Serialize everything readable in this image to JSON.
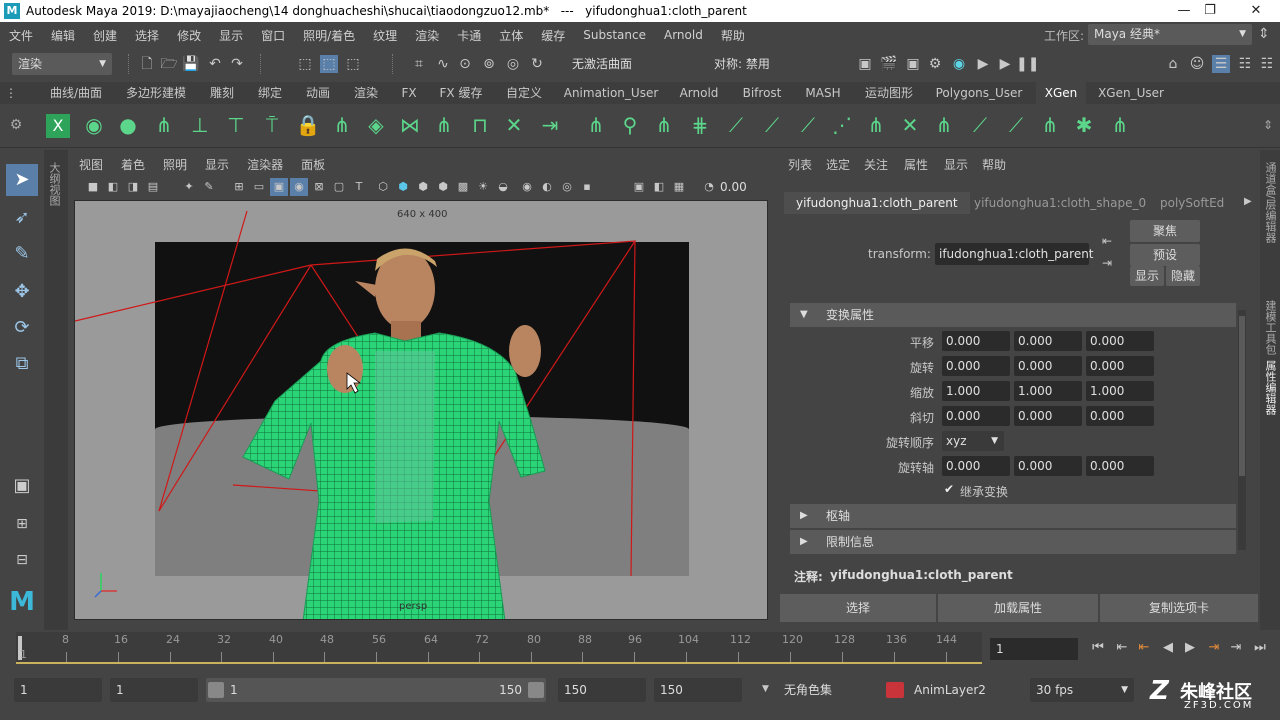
{
  "title_bar": {
    "title": "Autodesk Maya 2019: D:\\mayajiaocheng\\14 donghuacheshi\\shucai\\tiaodongzuo12.mb*   ---   yifudonghua1:cloth_parent",
    "logo": "M"
  },
  "menu": [
    "文件",
    "编辑",
    "创建",
    "选择",
    "修改",
    "显示",
    "窗口",
    "照明/着色",
    "纹理",
    "渲染",
    "卡通",
    "立体",
    "缓存",
    "Substance",
    "Arnold",
    "帮助"
  ],
  "workspace": {
    "label": "工作区:",
    "value": "Maya 经典*"
  },
  "status_line": {
    "menuset": "渲染",
    "live_surface": "无激活曲面",
    "symmetry": "对称: 禁用"
  },
  "shelf_tabs": [
    "曲线/曲面",
    "多边形建模",
    "雕刻",
    "绑定",
    "动画",
    "渲染",
    "FX",
    "FX 缓存",
    "自定义",
    "Animation_User",
    "Arnold",
    "Bifrost",
    "MASH",
    "运动图形",
    "Polygons_User",
    "XGen",
    "XGen_User"
  ],
  "shelf_active": "XGen",
  "panel_menu": [
    "视图",
    "着色",
    "照明",
    "显示",
    "渲染器",
    "面板"
  ],
  "panel_toolbar_value": "0.00",
  "viewport": {
    "resolution": "640 x 400",
    "camera": "persp"
  },
  "outliner_strip_label": "大纲视图",
  "attribute_editor": {
    "menu": [
      "列表",
      "选定",
      "关注",
      "属性",
      "显示",
      "帮助"
    ],
    "tabs": [
      "yifudonghua1:cloth_parent",
      "yifudonghua1:cloth_shape_0",
      "polySoftEd"
    ],
    "transform_label": "transform:",
    "transform_value": "ifudonghua1:cloth_parent",
    "btn_focus": "聚焦",
    "btn_presets": "预设",
    "btn_show": "显示",
    "btn_hide": "隐藏",
    "section_transform": "变换属性",
    "rows": [
      {
        "label": "平移",
        "x": "0.000",
        "y": "0.000",
        "z": "0.000"
      },
      {
        "label": "旋转",
        "x": "0.000",
        "y": "0.000",
        "z": "0.000"
      },
      {
        "label": "缩放",
        "x": "1.000",
        "y": "1.000",
        "z": "1.000"
      },
      {
        "label": "斜切",
        "x": "0.000",
        "y": "0.000",
        "z": "0.000"
      }
    ],
    "rotate_order_label": "旋转顺序",
    "rotate_order_value": "xyz",
    "rotate_axis_label": "旋转轴",
    "rotate_axis": {
      "x": "0.000",
      "y": "0.000",
      "z": "0.000"
    },
    "inherit_label": "继承变换",
    "section_pivot": "枢轴",
    "section_limit": "限制信息",
    "notes_label": "注释:",
    "notes_value": "yifudonghua1:cloth_parent",
    "btn_select": "选择",
    "btn_load": "加载属性",
    "btn_copy": "复制选项卡"
  },
  "side_strip": [
    "通道盒/层编辑器",
    "建模工具包",
    "属性编辑器"
  ],
  "timeline": {
    "ticks": [
      "1",
      "8",
      "16",
      "24",
      "32",
      "40",
      "48",
      "56",
      "64",
      "72",
      "80",
      "88",
      "96",
      "104",
      "112",
      "120",
      "128",
      "136",
      "144"
    ],
    "current_frame": "1"
  },
  "range": {
    "start": "1",
    "anim_start": "1",
    "slider_start": "1",
    "slider_end": "150",
    "end": "150",
    "anim_end": "150",
    "character_set": "无角色集",
    "anim_layer": "AnimLayer2",
    "fps": "30 fps"
  },
  "watermark": {
    "brand": "朱峰社区",
    "url": "ZF3D.COM"
  },
  "colors": {
    "accent": "#5cd68a",
    "wire": "#3cf08c",
    "camera_lines": "#d01818",
    "timeline_marker": "#c9b25b"
  }
}
